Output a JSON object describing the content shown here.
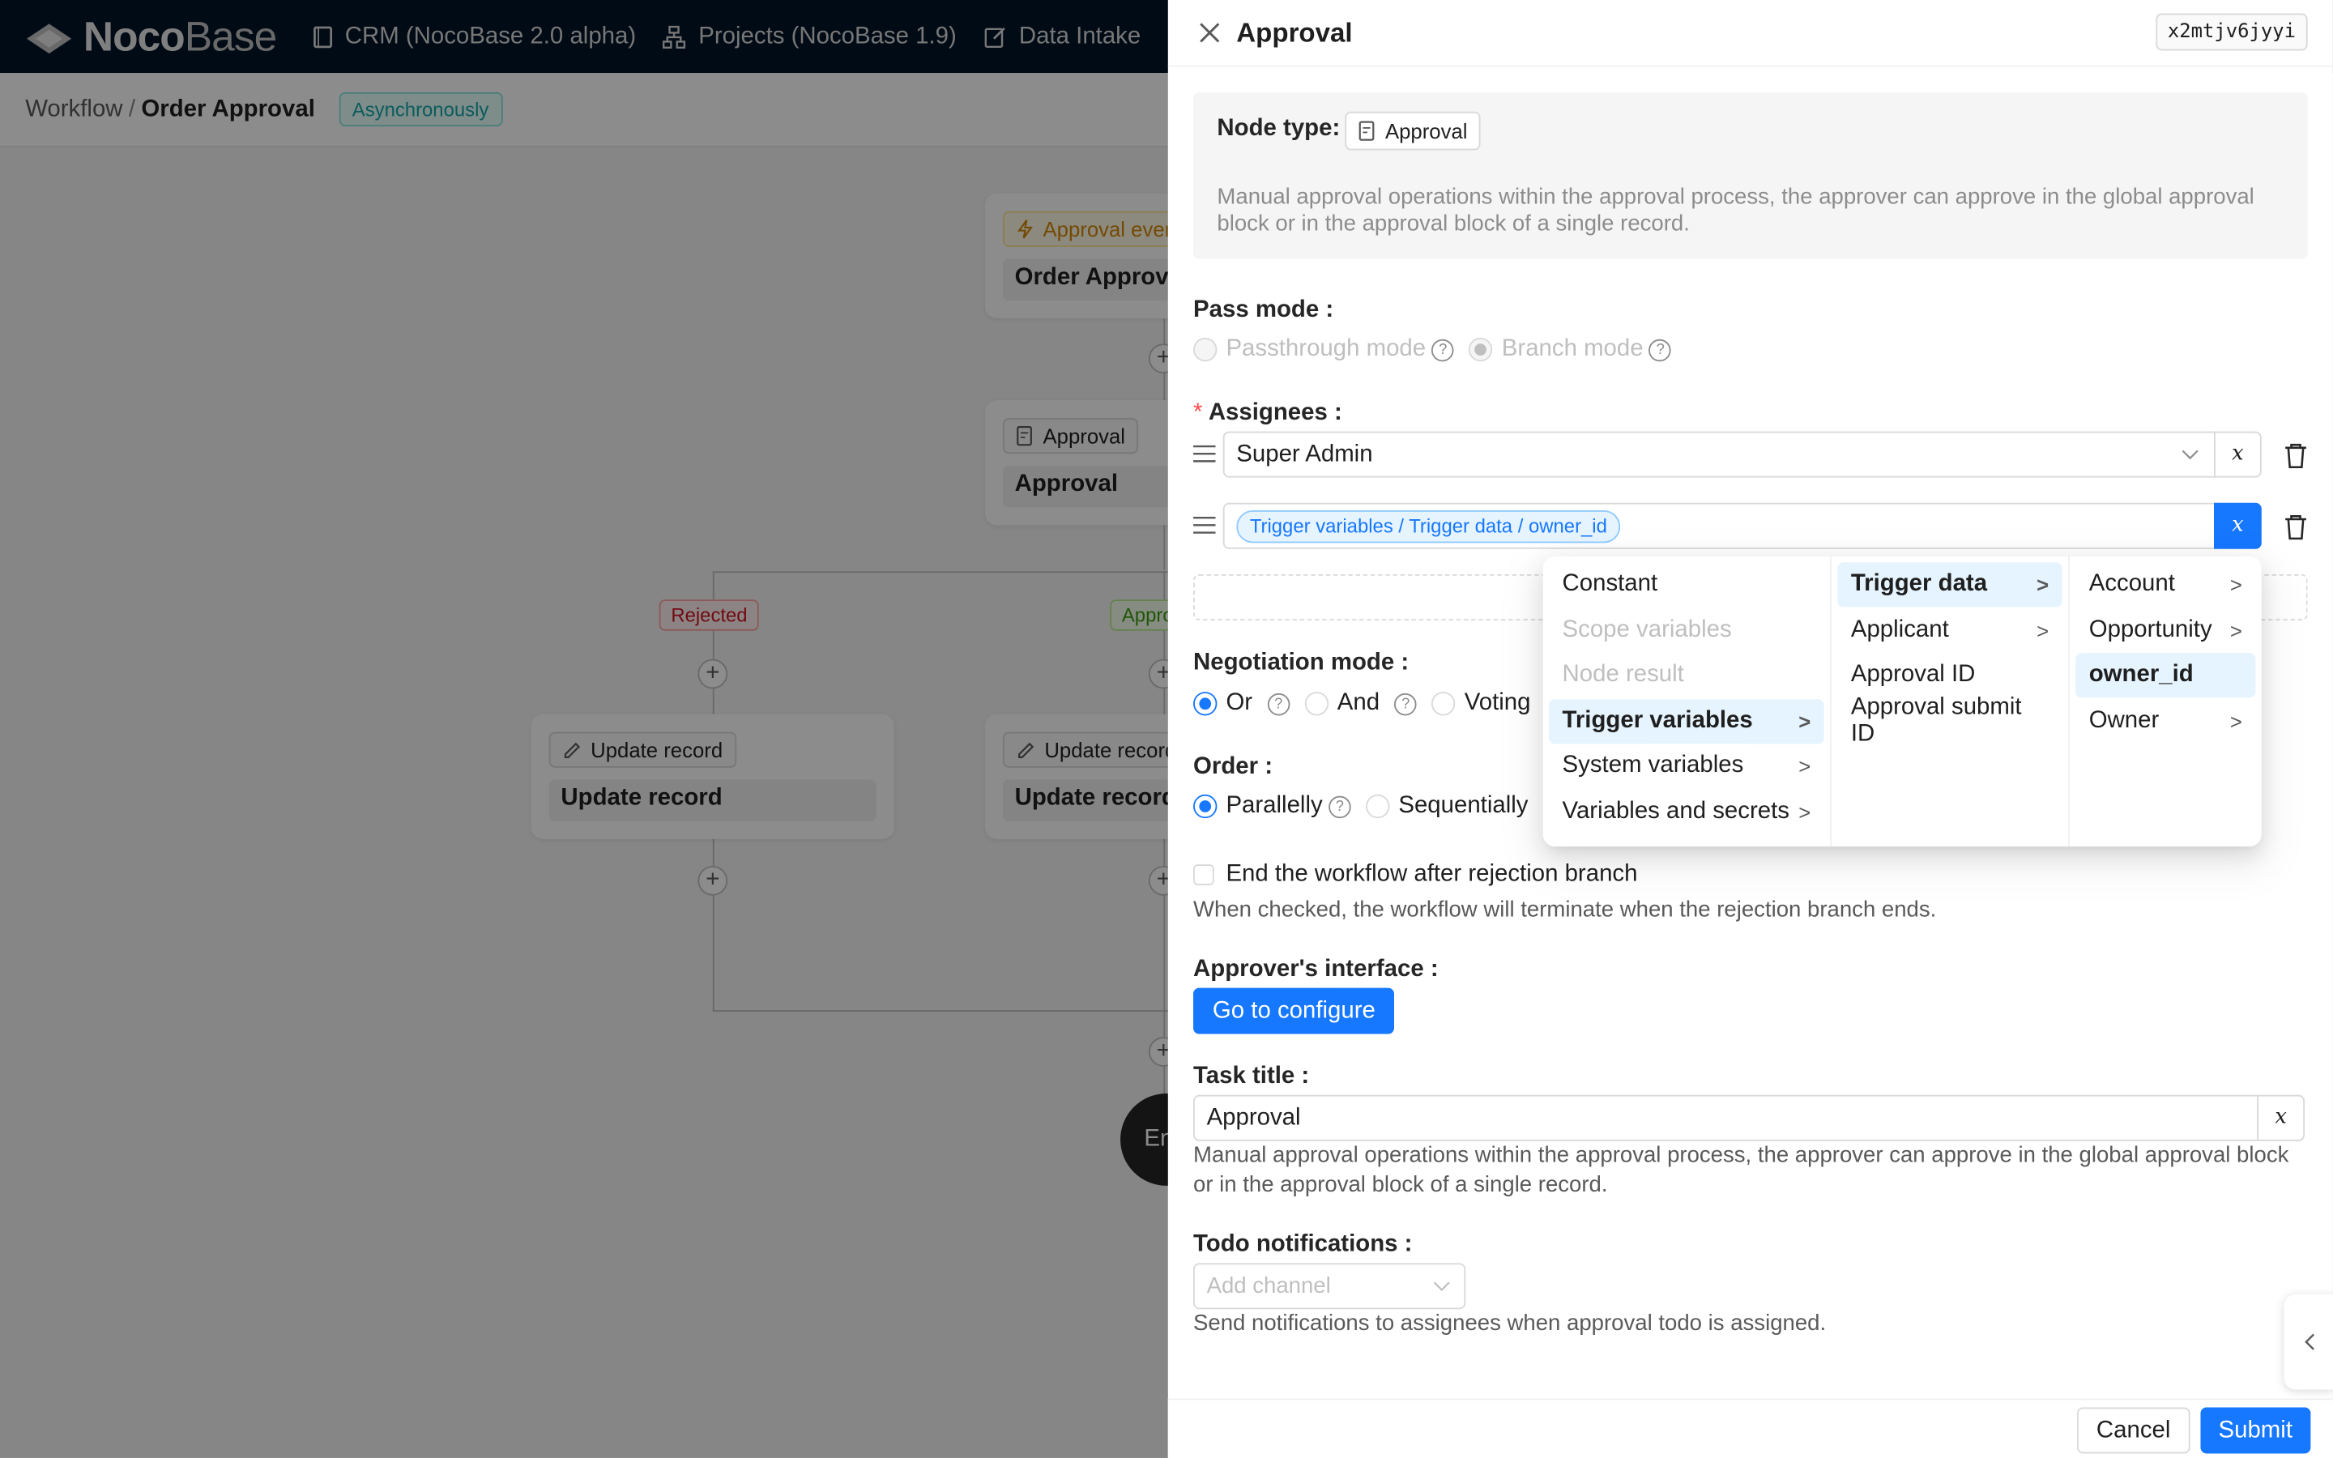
{
  "app": {
    "logo_bold": "Noco",
    "logo_thin": "Base",
    "nav": [
      {
        "label": "CRM (NocoBase 2.0 alpha)",
        "icon": "book-icon"
      },
      {
        "label": "Projects (NocoBase 1.9)",
        "icon": "org-icon"
      },
      {
        "label": "Data Intake",
        "icon": "form-icon"
      }
    ]
  },
  "breadcrumb": {
    "parent": "Workflow",
    "sep": "/",
    "current": "Order Approval",
    "mode_tag": "Asynchronously"
  },
  "canvas": {
    "trigger_tag": "Approval event",
    "trigger_title": "Order Approval",
    "approval_tag": "Approval",
    "approval_title": "Approval",
    "branch_rejected": "Rejected",
    "branch_approved": "Approved",
    "update_tag": "Update record",
    "update_title": "Update record",
    "end_label": "End"
  },
  "drawer": {
    "title": "Approval",
    "key": "x2mtjv6jyyi",
    "node_type_label": "Node type:",
    "node_type_value": "Approval",
    "node_type_desc": "Manual approval operations within the approval process, the approver can approve in the global approval block or in the approval block of a single record.",
    "pass_mode_label": "Pass mode",
    "pass_mode_options": [
      "Passthrough mode",
      "Branch mode"
    ],
    "assignees_label": "Assignees",
    "assignee_1": "Super Admin",
    "assignee_2_tag": "Trigger variables / Trigger data / owner_id",
    "var_button": "x",
    "negotiation_label": "Negotiation mode",
    "negotiation_options": [
      "Or",
      "And",
      "Voting"
    ],
    "order_label": "Order",
    "order_options": [
      "Parallelly",
      "Sequentially"
    ],
    "end_checkbox": "End the workflow after rejection branch",
    "end_help": "When checked, the workflow will terminate when the rejection branch ends.",
    "interface_label": "Approver's interface",
    "configure_button": "Go to configure",
    "task_title_label": "Task title",
    "task_title_value": "Approval",
    "task_title_help": "Manual approval operations within the approval process, the approver can approve in the global approval block or in the approval block of a single record.",
    "todo_label": "Todo notifications",
    "channel_placeholder": "Add channel",
    "todo_help": "Send notifications to assignees when approval todo is assigned.",
    "cancel": "Cancel",
    "submit": "Submit"
  },
  "cascader": {
    "col1": [
      {
        "label": "Constant",
        "disabled": false,
        "arrow": false
      },
      {
        "label": "Scope variables",
        "disabled": true,
        "arrow": false
      },
      {
        "label": "Node result",
        "disabled": true,
        "arrow": false
      },
      {
        "label": "Trigger variables",
        "disabled": false,
        "arrow": true,
        "selected": true
      },
      {
        "label": "System variables",
        "disabled": false,
        "arrow": true
      },
      {
        "label": "Variables and secrets",
        "disabled": false,
        "arrow": true
      }
    ],
    "col2": [
      {
        "label": "Trigger data",
        "arrow": true,
        "selected": true
      },
      {
        "label": "Applicant",
        "arrow": true
      },
      {
        "label": "Approval ID",
        "arrow": false
      },
      {
        "label": "Approval submit ID",
        "arrow": false
      }
    ],
    "col3": [
      {
        "label": "Account",
        "arrow": true
      },
      {
        "label": "Opportunity",
        "arrow": true
      },
      {
        "label": "owner_id",
        "arrow": false,
        "selected": true
      },
      {
        "label": "Owner",
        "arrow": true
      }
    ]
  },
  "colors": {
    "primary": "#1677ff",
    "header_bg": "#001529",
    "danger": "#ff4d4f"
  }
}
